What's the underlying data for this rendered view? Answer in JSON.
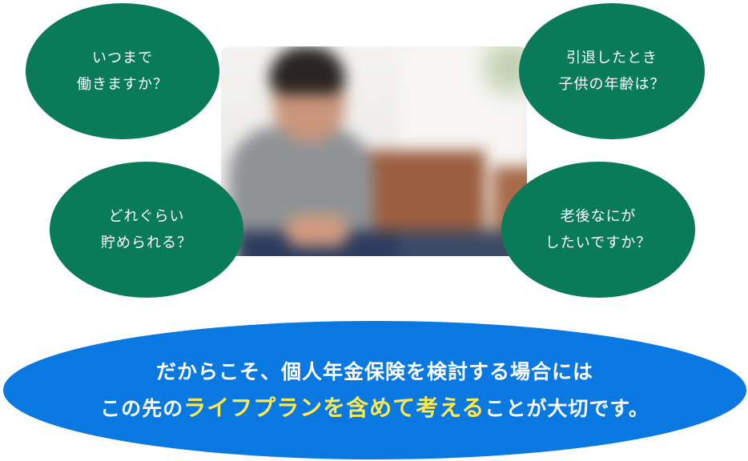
{
  "bubbles": {
    "top_left": {
      "line1": "いつまで",
      "line2": "働きますか？"
    },
    "bottom_left": {
      "line1": "どれぐらい",
      "line2": "貯められる？"
    },
    "top_right": {
      "line1": "引退したとき",
      "line2": "子供の年齢は？"
    },
    "bottom_right": {
      "line1": "老後なにが",
      "line2": "したいですか？"
    }
  },
  "banner": {
    "line1": "だからこそ、個人年金保険を検討する場合には",
    "line2_prefix": "この先の",
    "line2_highlight": "ライフプランを含めて考える",
    "line2_suffix": "ことが大切です。"
  },
  "colors": {
    "bubble": "#0a7b59",
    "banner": "#0a78e1",
    "highlight": "#ffe94a"
  },
  "icons": {
    "photo": "person-sitting-photo"
  }
}
